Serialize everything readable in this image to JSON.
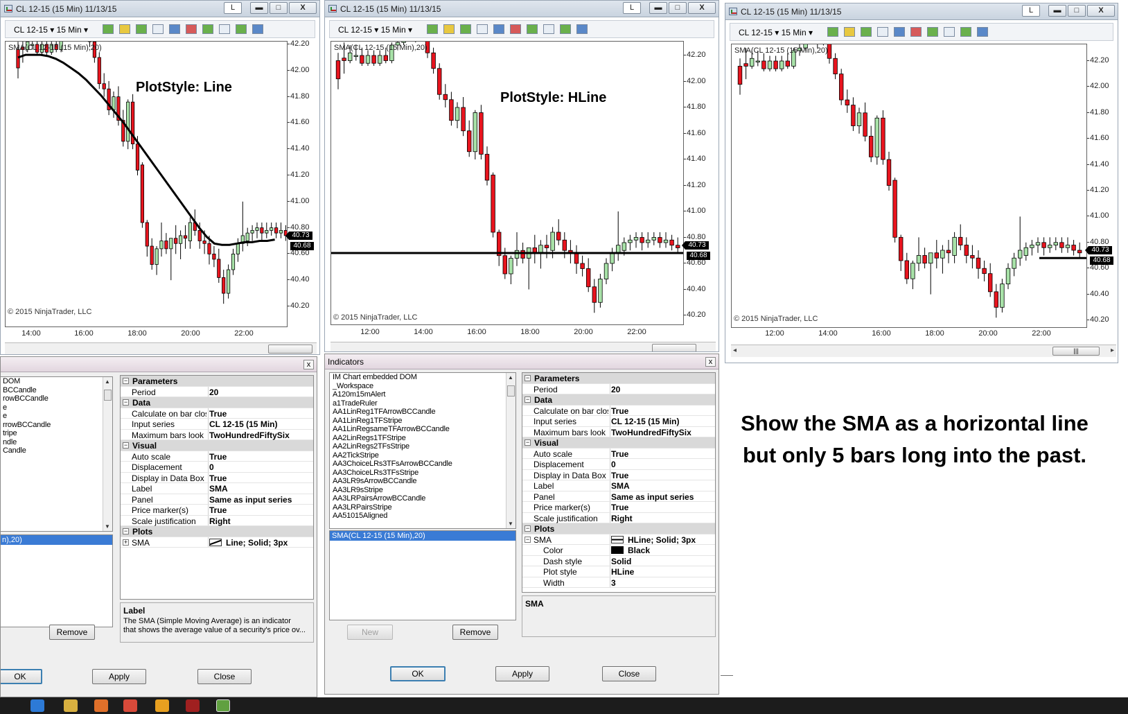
{
  "colors": {
    "up": "#a8e2a8",
    "down": "#e8141e",
    "line": "#000000"
  },
  "window_title": "CL 12-15 (15 Min)  11/13/15",
  "window_buttons": {
    "layout": "L",
    "minimize": "▬",
    "maximize": "□",
    "close": "X"
  },
  "toolbar": {
    "instrument": "CL 12-15  ▾  15 Min  ▾"
  },
  "chart_common": {
    "indicator_label": "SMA(CL 12-15 (15 Min),20)",
    "copyright": "© 2015 NinjaTrader, LLC",
    "price_last": "40.73",
    "price_sma": "40.68"
  },
  "chart1": {
    "plot_style": "PlotStyle: Line",
    "y_ticks": [
      "42.20",
      "42.00",
      "41.80",
      "41.60",
      "41.40",
      "41.20",
      "41.00",
      "40.80",
      "40.60",
      "40.40",
      "40.20"
    ],
    "x_ticks": [
      "14:00",
      "16:00",
      "18:00",
      "20:00",
      "22:00"
    ]
  },
  "chart2": {
    "plot_style": "PlotStyle: HLine",
    "y_ticks": [
      "42.20",
      "42.00",
      "41.80",
      "41.60",
      "41.40",
      "41.20",
      "41.00",
      "40.80",
      "40.60",
      "40.40",
      "40.20"
    ],
    "x_ticks": [
      "12:00",
      "14:00",
      "16:00",
      "18:00",
      "20:00",
      "22:00"
    ]
  },
  "chart3": {
    "y_ticks": [
      "42.20",
      "42.00",
      "41.80",
      "41.60",
      "41.40",
      "41.20",
      "41.00",
      "40.80",
      "40.60",
      "40.40",
      "40.20"
    ],
    "x_ticks": [
      "12:00",
      "14:00",
      "16:00",
      "18:00",
      "20:00",
      "22:00"
    ]
  },
  "candles": [
    {
      "o": 42.16,
      "h": 42.22,
      "l": 41.94,
      "c": 42.02
    },
    {
      "o": 42.18,
      "h": 42.3,
      "l": 42.06,
      "c": 42.16
    },
    {
      "o": 42.16,
      "h": 42.28,
      "l": 42.14,
      "c": 42.22
    },
    {
      "o": 42.2,
      "h": 42.28,
      "l": 42.16,
      "c": 42.2
    },
    {
      "o": 42.2,
      "h": 42.26,
      "l": 42.12,
      "c": 42.14
    },
    {
      "o": 42.14,
      "h": 42.24,
      "l": 42.12,
      "c": 42.2
    },
    {
      "o": 42.2,
      "h": 42.24,
      "l": 42.12,
      "c": 42.14
    },
    {
      "o": 42.14,
      "h": 42.24,
      "l": 42.12,
      "c": 42.2
    },
    {
      "o": 42.2,
      "h": 42.26,
      "l": 42.14,
      "c": 42.16
    },
    {
      "o": 42.16,
      "h": 42.3,
      "l": 42.14,
      "c": 42.28
    },
    {
      "o": 42.28,
      "h": 42.38,
      "l": 42.24,
      "c": 42.3
    },
    {
      "o": 42.3,
      "h": 42.44,
      "l": 42.28,
      "c": 42.4
    },
    {
      "o": 42.4,
      "h": 42.5,
      "l": 42.36,
      "c": 42.38
    },
    {
      "o": 42.38,
      "h": 42.52,
      "l": 42.3,
      "c": 42.46
    },
    {
      "o": 42.46,
      "h": 42.54,
      "l": 42.32,
      "c": 42.34
    },
    {
      "o": 42.34,
      "h": 42.4,
      "l": 42.18,
      "c": 42.22
    },
    {
      "o": 42.22,
      "h": 42.26,
      "l": 42.06,
      "c": 42.1
    },
    {
      "o": 42.1,
      "h": 42.14,
      "l": 41.86,
      "c": 41.9
    },
    {
      "o": 41.9,
      "h": 41.98,
      "l": 41.8,
      "c": 41.86
    },
    {
      "o": 41.86,
      "h": 41.92,
      "l": 41.66,
      "c": 41.7
    },
    {
      "o": 41.7,
      "h": 41.84,
      "l": 41.64,
      "c": 41.8
    },
    {
      "o": 41.8,
      "h": 41.88,
      "l": 41.58,
      "c": 41.62
    },
    {
      "o": 41.62,
      "h": 41.7,
      "l": 41.42,
      "c": 41.46
    },
    {
      "o": 41.46,
      "h": 41.78,
      "l": 41.4,
      "c": 41.76
    },
    {
      "o": 41.76,
      "h": 41.82,
      "l": 41.4,
      "c": 41.44
    },
    {
      "o": 41.44,
      "h": 41.5,
      "l": 41.2,
      "c": 41.24
    },
    {
      "o": 41.28,
      "h": 41.3,
      "l": 40.8,
      "c": 40.84
    },
    {
      "o": 40.84,
      "h": 40.86,
      "l": 40.58,
      "c": 40.66
    },
    {
      "o": 40.66,
      "h": 40.72,
      "l": 40.48,
      "c": 40.52
    },
    {
      "o": 40.52,
      "h": 40.66,
      "l": 40.44,
      "c": 40.64
    },
    {
      "o": 40.64,
      "h": 40.84,
      "l": 40.58,
      "c": 40.7
    },
    {
      "o": 40.7,
      "h": 40.76,
      "l": 40.6,
      "c": 40.64
    },
    {
      "o": 40.64,
      "h": 40.72,
      "l": 40.4,
      "c": 40.72
    },
    {
      "o": 40.72,
      "h": 40.82,
      "l": 40.6,
      "c": 40.68
    },
    {
      "o": 40.68,
      "h": 40.78,
      "l": 40.56,
      "c": 40.74
    },
    {
      "o": 40.74,
      "h": 40.82,
      "l": 40.64,
      "c": 40.72
    },
    {
      "o": 40.7,
      "h": 40.88,
      "l": 40.64,
      "c": 40.84
    },
    {
      "o": 40.84,
      "h": 40.94,
      "l": 40.74,
      "c": 40.78
    },
    {
      "o": 40.78,
      "h": 40.84,
      "l": 40.64,
      "c": 40.7
    },
    {
      "o": 40.7,
      "h": 40.78,
      "l": 40.6,
      "c": 40.68
    },
    {
      "o": 40.68,
      "h": 40.74,
      "l": 40.52,
      "c": 40.6
    },
    {
      "o": 40.6,
      "h": 40.66,
      "l": 40.5,
      "c": 40.56
    },
    {
      "o": 40.56,
      "h": 40.64,
      "l": 40.38,
      "c": 40.42
    },
    {
      "o": 40.42,
      "h": 40.48,
      "l": 40.22,
      "c": 40.3
    },
    {
      "o": 40.3,
      "h": 40.52,
      "l": 40.26,
      "c": 40.48
    },
    {
      "o": 40.48,
      "h": 40.64,
      "l": 40.44,
      "c": 40.6
    },
    {
      "o": 40.6,
      "h": 40.72,
      "l": 40.54,
      "c": 40.68
    },
    {
      "o": 40.68,
      "h": 41.0,
      "l": 40.62,
      "c": 40.74
    },
    {
      "o": 40.7,
      "h": 40.8,
      "l": 40.66,
      "c": 40.76
    },
    {
      "o": 40.76,
      "h": 40.82,
      "l": 40.7,
      "c": 40.78
    },
    {
      "o": 40.78,
      "h": 40.84,
      "l": 40.72,
      "c": 40.8
    },
    {
      "o": 40.8,
      "h": 40.84,
      "l": 40.7,
      "c": 40.76
    },
    {
      "o": 40.76,
      "h": 40.84,
      "l": 40.72,
      "c": 40.78
    },
    {
      "o": 40.78,
      "h": 40.84,
      "l": 40.74,
      "c": 40.8
    },
    {
      "o": 40.8,
      "h": 40.84,
      "l": 40.72,
      "c": 40.76
    },
    {
      "o": 40.76,
      "h": 40.84,
      "l": 40.72,
      "c": 40.78
    },
    {
      "o": 40.78,
      "h": 40.82,
      "l": 40.7,
      "c": 40.74
    },
    {
      "o": 40.74,
      "h": 40.8,
      "l": 40.68,
      "c": 40.72
    }
  ],
  "sma_values": [
    42.1,
    42.12,
    42.12,
    42.12,
    42.11,
    42.09,
    42.06,
    42.02,
    41.98,
    41.93,
    41.87,
    41.81,
    41.74,
    41.67,
    41.6,
    41.52,
    41.44,
    41.36,
    41.28,
    41.2,
    41.12,
    41.04,
    40.96,
    40.88,
    40.8,
    40.73,
    40.68,
    40.67,
    40.67,
    40.68,
    40.69,
    40.69,
    40.7,
    40.7,
    40.71
  ],
  "hline_value": 40.68,
  "dialog1": {
    "list_items": [
      "DOM",
      "",
      "",
      "",
      "BCCandle",
      "",
      "rowBCCandle",
      "e",
      "e",
      "",
      "rrowBCCandle",
      "tripe",
      "ndle",
      "",
      "Candle"
    ],
    "selected": "n),20)",
    "remove": "Remove",
    "ok": "OK",
    "apply": "Apply",
    "close": "Close",
    "help_title": "Label",
    "help_text_1": "The SMA (Simple Moving Average) is an indicator",
    "help_text_2": "that shows the average value of a security's price ov..."
  },
  "dialog2": {
    "title": "Indicators",
    "list_items": [
      "IM Chart embedded DOM",
      "_Workspace",
      "A120m15mAlert",
      "a1TradeRuler",
      "AA1LinReg1TFArrowBCCandle",
      "AA1LinReg1TFStripe",
      "AA1LinRegsameTFArrowBCCandle",
      "AA2LinRegs1TFStripe",
      "AA2LinRegs2TFsStripe",
      "AA2TickStripe",
      "AA3ChoiceLRs3TFsArrowBCCandle",
      "AA3ChoiceLRs3TFsStripe",
      "AA3LR9sArrowBCCandle",
      "AA3LR9sStripe",
      "AA3LRPairsArrowBCCandle",
      "AA3LRPairsStripe",
      "AA51015Aligned"
    ],
    "selected": "SMA(CL 12-15 (15 Min),20)",
    "new": "New",
    "remove": "Remove",
    "ok": "OK",
    "apply": "Apply",
    "close": "Close",
    "help_title": "SMA"
  },
  "props": {
    "cat_parameters": "Parameters",
    "cat_data": "Data",
    "cat_visual": "Visual",
    "cat_plots": "Plots",
    "period_label": "Period",
    "period_value": "20",
    "calc_label": "Calculate on bar close",
    "calc_value": "True",
    "input_label": "Input series",
    "input_value": "CL 12-15 (15 Min)",
    "maxbars_label": "Maximum bars look back",
    "maxbars_value": "TwoHundredFiftySix",
    "autoscale_label": "Auto scale",
    "autoscale_value": "True",
    "displacement_label": "Displacement",
    "displacement_value": "0",
    "databox_label": "Display in Data Box",
    "databox_value": "True",
    "label_label": "Label",
    "label_value": "SMA",
    "panel_label": "Panel",
    "panel_value": "Same as input series",
    "pricemarker_label": "Price marker(s)",
    "pricemarker_value": "True",
    "scalejust_label": "Scale justification",
    "scalejust_value": "Right",
    "sma_label": "SMA",
    "sma_line_value": "Line; Solid; 3px",
    "sma_hline_value": "HLine; Solid; 3px",
    "color_label": "Color",
    "color_value": "Black",
    "dash_label": "Dash style",
    "dash_value": "Solid",
    "plotstyle_label": "Plot style",
    "plotstyle_value": "HLine",
    "width_label": "Width",
    "width_value": "3"
  },
  "annotation": {
    "line1": "Show the SMA as a horizontal line",
    "line2": "but only 5 bars long into the past."
  }
}
